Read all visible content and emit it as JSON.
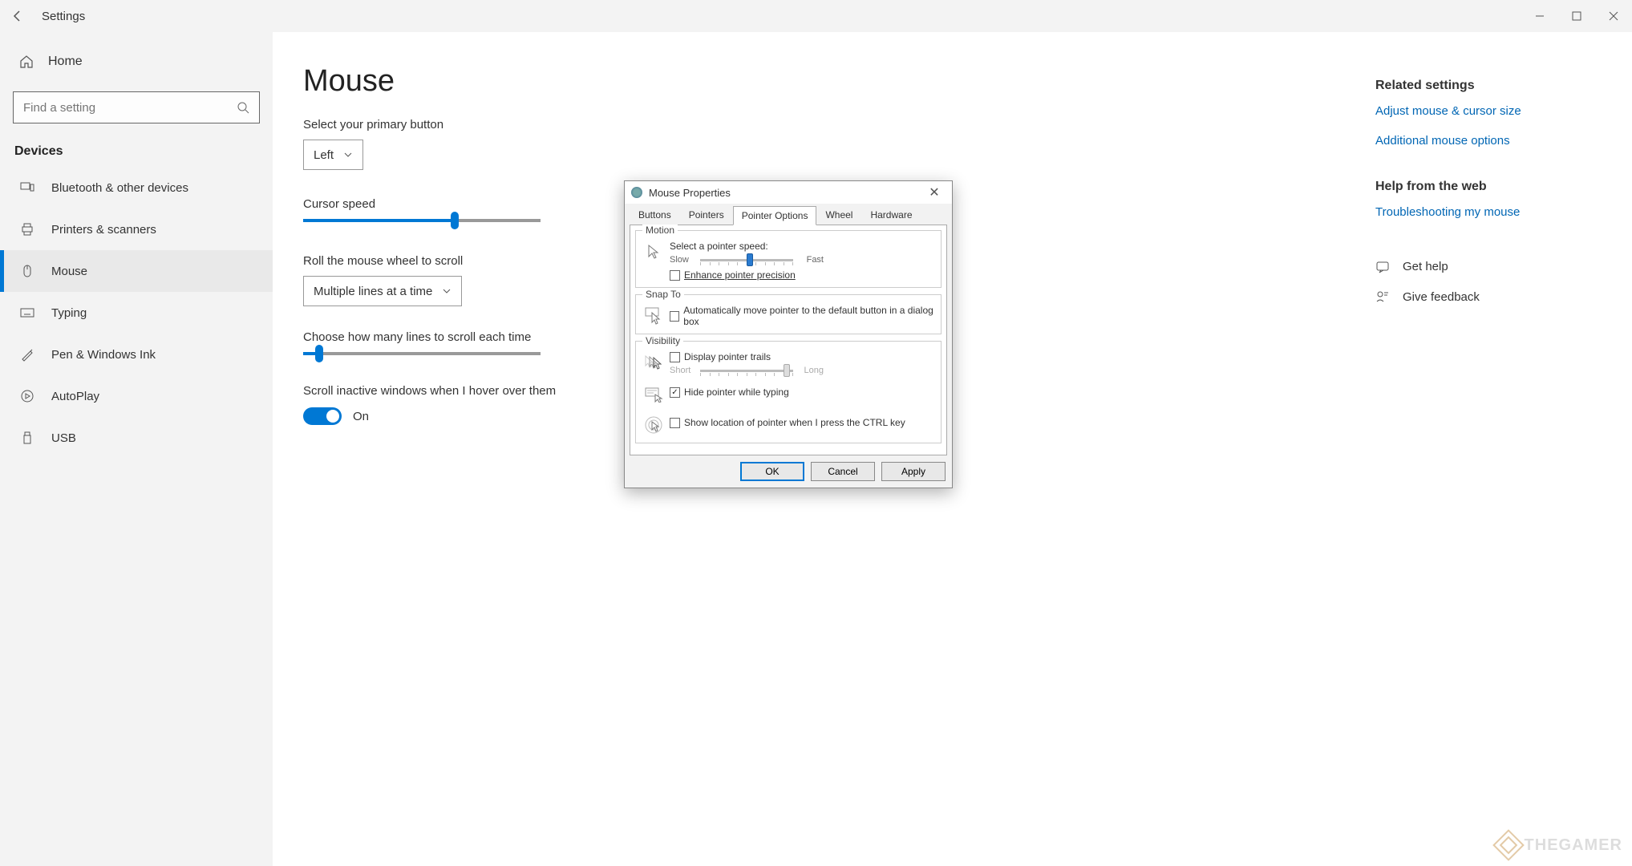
{
  "titlebar": {
    "title": "Settings"
  },
  "sidebar": {
    "home": "Home",
    "search_placeholder": "Find a setting",
    "section": "Devices",
    "items": [
      {
        "label": "Bluetooth & other devices"
      },
      {
        "label": "Printers & scanners"
      },
      {
        "label": "Mouse"
      },
      {
        "label": "Typing"
      },
      {
        "label": "Pen & Windows Ink"
      },
      {
        "label": "AutoPlay"
      },
      {
        "label": "USB"
      }
    ]
  },
  "content": {
    "page_title": "Mouse",
    "primary_btn_label": "Select your primary button",
    "primary_btn_value": "Left",
    "cursor_speed_label": "Cursor speed",
    "cursor_speed_percent": 62,
    "wheel_label": "Roll the mouse wheel to scroll",
    "wheel_value": "Multiple lines at a time",
    "lines_label": "Choose how many lines to scroll each time",
    "lines_percent": 5,
    "inactive_label": "Scroll inactive windows when I hover over them",
    "inactive_state": "On"
  },
  "rightpanel": {
    "related_header": "Related settings",
    "link1": "Adjust mouse & cursor size",
    "link2": "Additional mouse options",
    "web_header": "Help from the web",
    "link3": "Troubleshooting my mouse",
    "help": "Get help",
    "feedback": "Give feedback"
  },
  "dialog": {
    "title": "Mouse Properties",
    "tabs": [
      "Buttons",
      "Pointers",
      "Pointer Options",
      "Wheel",
      "Hardware"
    ],
    "motion": {
      "legend": "Motion",
      "label": "Select a pointer speed:",
      "slow": "Slow",
      "fast": "Fast",
      "speed_percent": 50,
      "enhance": "Enhance pointer precision",
      "enhance_checked": false
    },
    "snapto": {
      "legend": "Snap To",
      "label": "Automatically move pointer to the default button in a dialog box",
      "checked": false
    },
    "visibility": {
      "legend": "Visibility",
      "trails_label": "Display pointer trails",
      "trails_checked": false,
      "short": "Short",
      "long": "Long",
      "trails_percent": 90,
      "hide_label": "Hide pointer while typing",
      "hide_checked": true,
      "ctrl_label": "Show location of pointer when I press the CTRL key",
      "ctrl_checked": false
    },
    "buttons": {
      "ok": "OK",
      "cancel": "Cancel",
      "apply": "Apply"
    }
  },
  "watermark": "THEGAMER"
}
